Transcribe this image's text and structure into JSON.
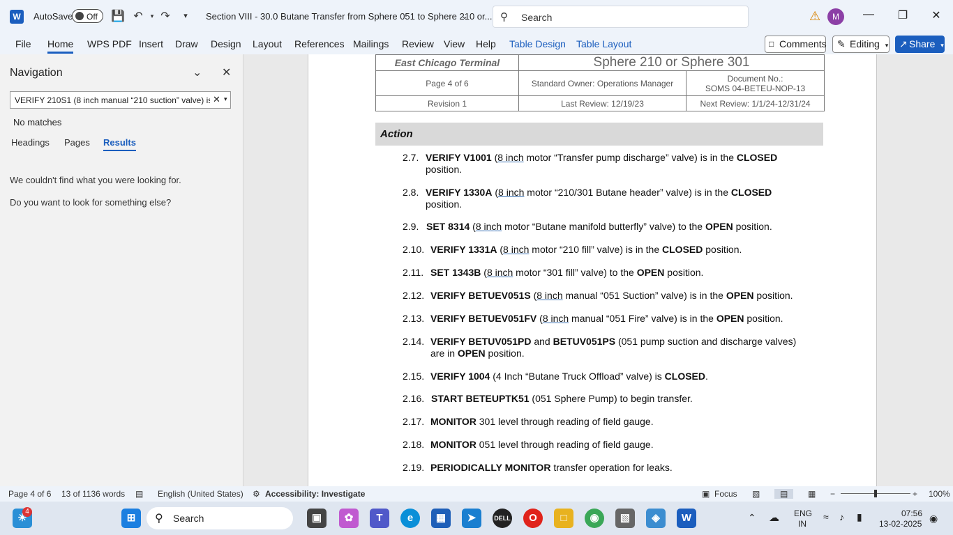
{
  "titlebar": {
    "app_logo": "W",
    "autosave_label": "AutoSave",
    "autosave_state": "Off",
    "doc_title": "Section VIII - 30.0 Butane Transfer from Sphere 051 to Sphere 210 or...",
    "search_placeholder": "Search",
    "avatar_initial": "M"
  },
  "ribbon": {
    "tabs": [
      "File",
      "Home",
      "WPS PDF",
      "Insert",
      "Draw",
      "Design",
      "Layout",
      "References",
      "Mailings",
      "Review",
      "View",
      "Help",
      "Table Design",
      "Table Layout"
    ],
    "comments_label": "Comments",
    "editing_label": "Editing",
    "share_label": "Share"
  },
  "nav": {
    "title": "Navigation",
    "search_value": "VERIFY 210S1 (8 inch manual “210 suction” valve) is i",
    "no_matches": "No matches",
    "tabs": [
      "Headings",
      "Pages",
      "Results"
    ],
    "msg1": "We couldn't find what you were looking for.",
    "msg2": "Do you want to look for something else?"
  },
  "doc": {
    "header": {
      "terminal": "East Chicago Terminal",
      "sphere": "Sphere 210 or Sphere 301",
      "page": "Page 4 of 6",
      "owner": "Standard Owner: Operations Manager",
      "docno_label": "Document No.:",
      "docno": "SOMS 04-BETEU-NOP-13",
      "revision": "Revision 1",
      "last_review": "Last Review: 12/19/23",
      "next_review": "Next Review: 1/1/24-12/31/24"
    },
    "action_label": "Action",
    "steps": [
      {
        "num": "2.7.",
        "b1": "VERIFY V1001",
        "p1": " (",
        "u": "8 inch",
        "p2": " motor “Transfer pump discharge” valve) is in the ",
        "b2": "CLOSED",
        "p3": "",
        "line2": "position."
      },
      {
        "num": "2.8.",
        "b1": "VERIFY 1330A",
        "p1": " (",
        "u": "8 inch",
        "p2": " motor “210/301 Butane header” valve) is in the ",
        "b2": "CLOSED",
        "p3": "",
        "line2": "position."
      },
      {
        "num": "2.9.",
        "b1": "SET 8314",
        "p1": " (",
        "u": "8 inch",
        "p2": " motor “Butane manifold butterfly” valve) to the ",
        "b2": "OPEN",
        "p3": " position."
      },
      {
        "num": "2.10.",
        "b1": "VERIFY 1331A",
        "p1": " (",
        "u": "8 inch",
        "p2": " motor “210 fill” valve) is in the ",
        "b2": "CLOSED",
        "p3": " position."
      },
      {
        "num": "2.11.",
        "b1": "SET 1343B",
        "p1": " (",
        "u": "8 inch",
        "p2": " motor “301 fill” valve) to the ",
        "b2": "OPEN",
        "p3": " position."
      },
      {
        "num": "2.12.",
        "b1": "VERIFY BETUEV051S",
        "p1": " (",
        "u": "8 inch",
        "p2": " manual “051 Suction” valve) is in the ",
        "b2": "OPEN",
        "p3": " position."
      },
      {
        "num": "2.13.",
        "b1": "VERIFY BETUEV051FV",
        "p1": " (",
        "u": "8 inch",
        "p2": " manual “051 Fire” valve) is in the ",
        "b2": "OPEN",
        "p3": " position."
      },
      {
        "num": "2.14.",
        "b1": "VERIFY BETUV051PD",
        "p1": " and ",
        "u": "",
        "p2": "",
        "b2": "BETUV051PS",
        "p3": " (051 pump suction and discharge valves)",
        "line2a": "are in ",
        "line2b": "OPEN",
        "line2c": " position."
      },
      {
        "num": "2.15.",
        "b1": "VERIFY 1004",
        "p1": " (4 Inch “Butane Truck Offload” valve) is ",
        "u": "",
        "p2": "",
        "b2": "CLOSED",
        "p3": "."
      },
      {
        "num": "2.16.",
        "b1": "START BETEUPTK51",
        "p1": " (051 Sphere Pump) to begin transfer.",
        "u": "",
        "p2": "",
        "b2": "",
        "p3": ""
      },
      {
        "num": "2.17.",
        "b1": "MONITOR",
        "p1": " 301 level through reading of field gauge.",
        "u": "",
        "p2": "",
        "b2": "",
        "p3": ""
      },
      {
        "num": "2.18.",
        "b1": "MONITOR",
        "p1": " 051 level through reading of field gauge.",
        "u": "",
        "p2": "",
        "b2": "",
        "p3": ""
      },
      {
        "num": "2.19.",
        "b1": "PERIODICALLY MONITOR",
        "p1": " transfer operation for leaks.",
        "u": "",
        "p2": "",
        "b2": "",
        "p3": ""
      }
    ]
  },
  "status": {
    "page": "Page 4 of 6",
    "words": "13 of 1136 words",
    "language": "English (United States)",
    "accessibility": "Accessibility: Investigate",
    "focus": "Focus",
    "zoom": "100%",
    "zoom_level": 1.0
  },
  "taskbar": {
    "search_label": "Search",
    "badge": "4",
    "lang1": "ENG",
    "lang2": "IN",
    "time": "07:56",
    "date": "13-02-2025",
    "dell": "DELL"
  },
  "colors": {
    "accent": "#1b5ebe",
    "warning": "#d98300"
  }
}
